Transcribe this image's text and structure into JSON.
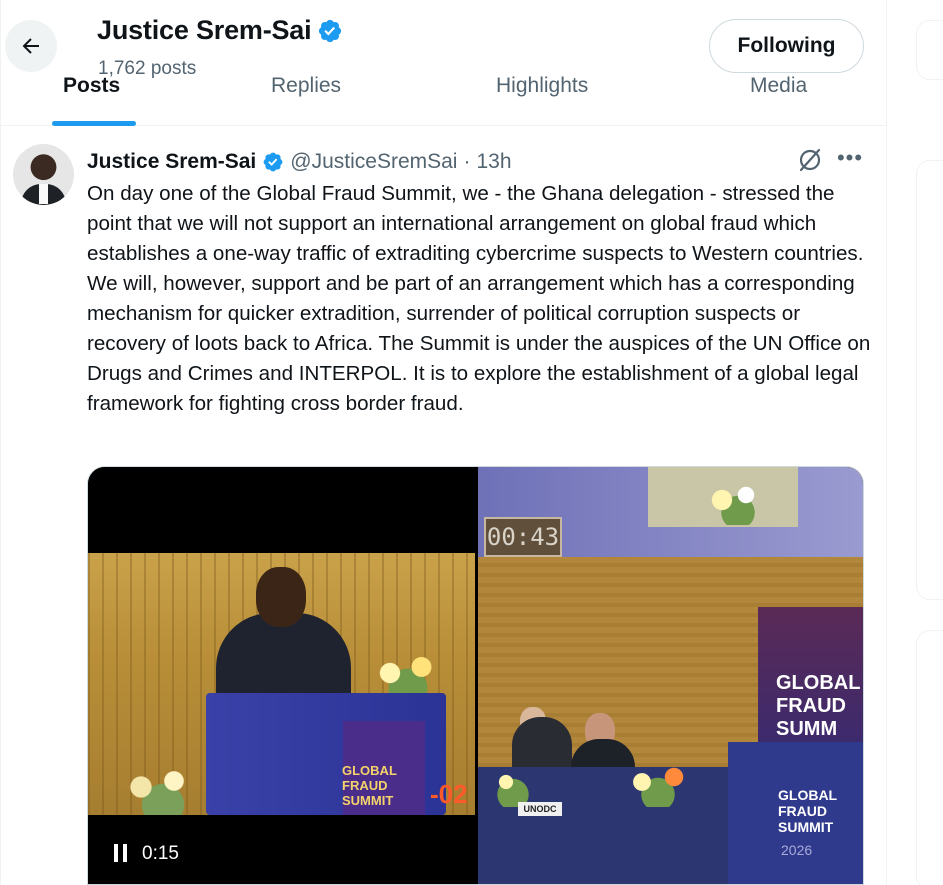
{
  "header": {
    "name": "Justice Srem-Sai",
    "post_count": "1,762 posts",
    "follow_label": "Following"
  },
  "tabs": [
    {
      "label": "Posts",
      "active": true
    },
    {
      "label": "Replies",
      "active": false
    },
    {
      "label": "Highlights",
      "active": false
    },
    {
      "label": "Media",
      "active": false
    }
  ],
  "tweet": {
    "name": "Justice Srem-Sai",
    "handle": "@JusticeSremSai",
    "separator": "·",
    "time": "13h",
    "text": "On day one of the Global Fraud Summit, we - the Ghana delegation - stressed the point that we will not support an international arrangement on global fraud which establishes a one-way traffic of extraditing cybercrime suspects to Western countries. We will, however, support and be part of an arrangement which has a corresponding mechanism for quicker extradition, surrender of political corruption suspects or recovery of loots back to Africa. The Summit is under the auspices of the UN Office on Drugs and Crimes and INTERPOL. It is to explore the establishment of a global legal framework for fighting cross border fraud.",
    "media": {
      "video_time": "0:15",
      "left_banner": "GLOBAL FRAUD SUMMIT",
      "left_overlay_number": "-02",
      "right_timer": "00:43",
      "right_banner": "GLOBAL FRAUD SUMM",
      "right_dais": "GLOBAL FRAUD SUMMIT",
      "right_year": "2026",
      "name_card": "UNODC"
    }
  },
  "colors": {
    "accent": "#1d9bf0",
    "verified": "#1d9bf0",
    "text_primary": "#0f1419",
    "text_secondary": "#536471"
  },
  "icons": {
    "back": "arrow-left-icon",
    "verified": "verified-badge-icon",
    "grok": "grok-icon",
    "more": "more-dots-icon",
    "pause": "pause-icon"
  }
}
